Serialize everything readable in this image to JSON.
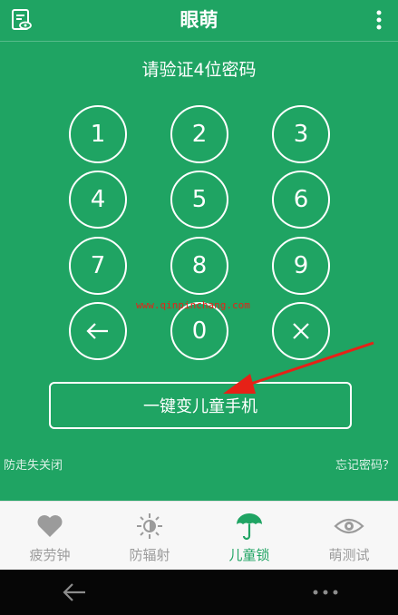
{
  "app": {
    "title": "眼萌"
  },
  "prompt": "请验证4位密码",
  "keypad": [
    "1",
    "2",
    "3",
    "4",
    "5",
    "6",
    "7",
    "8",
    "9",
    "0"
  ],
  "watermark": "www.qinpinchang.com",
  "action_button": "一键变儿童手机",
  "links": {
    "left": "防走失关闭",
    "right": "忘记密码？"
  },
  "tabs": [
    {
      "label": "疲劳钟",
      "icon": "heart-icon"
    },
    {
      "label": "防辐射",
      "icon": "sun-icon"
    },
    {
      "label": "儿童锁",
      "icon": "umbrella-icon",
      "active": true
    },
    {
      "label": "萌测试",
      "icon": "eye-icon"
    }
  ],
  "colors": {
    "brand": "#1fa463",
    "annotation": "#e62117"
  }
}
